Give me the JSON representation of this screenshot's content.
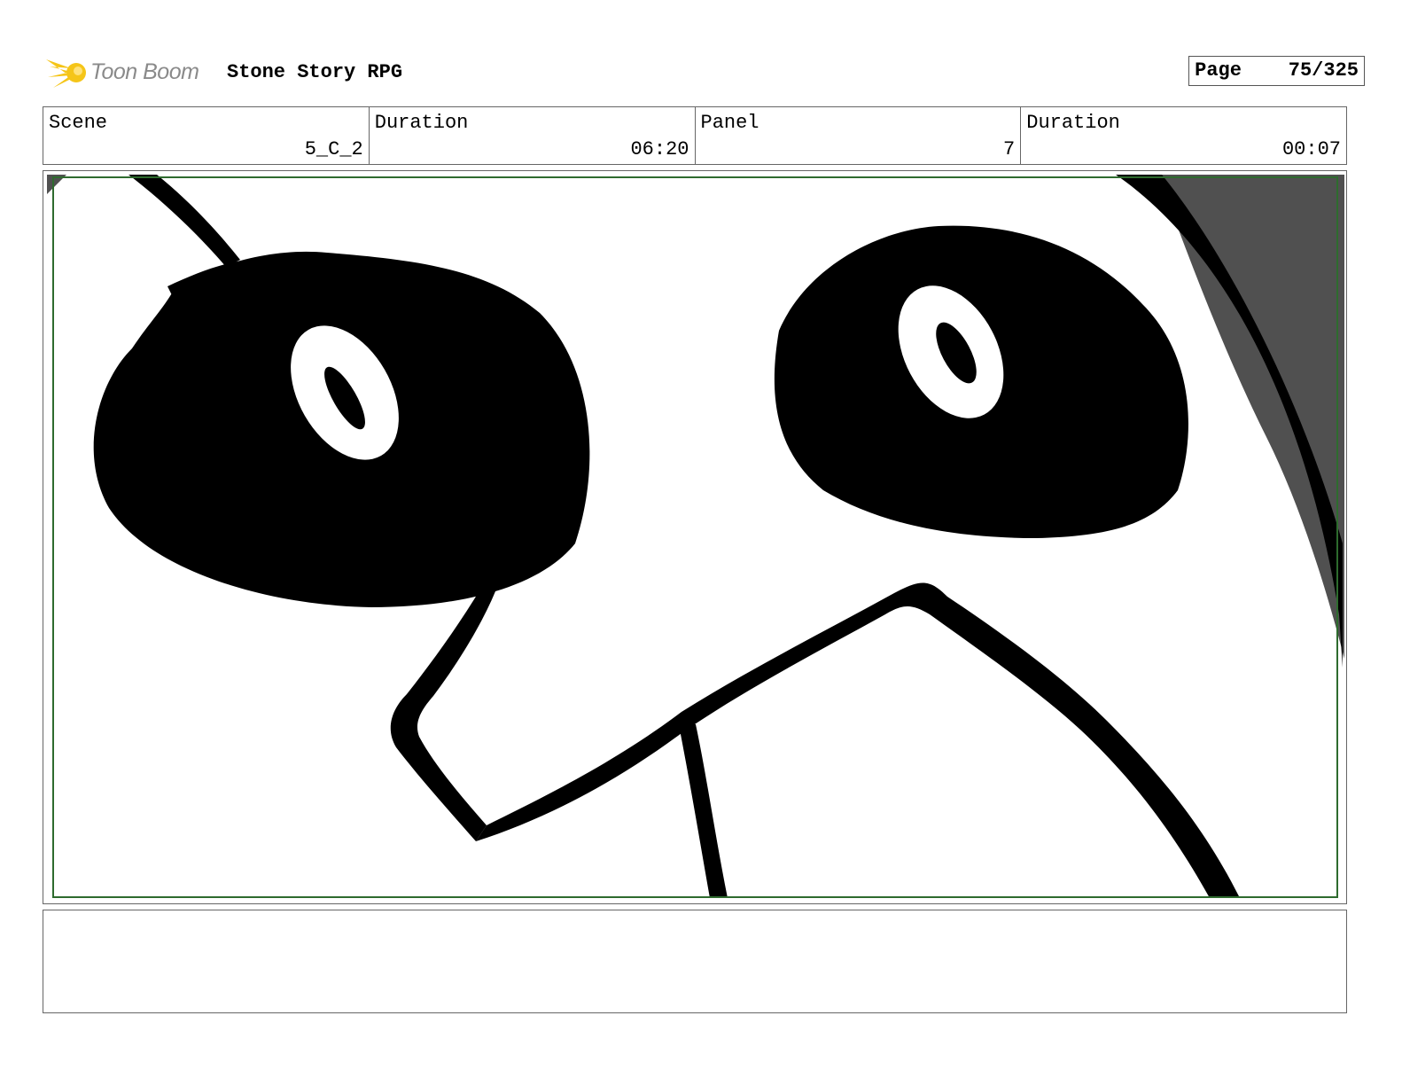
{
  "header": {
    "logo_text": "Toon Boom",
    "project_title": "Stone Story RPG",
    "page_label": "Page",
    "page_value": "75/325"
  },
  "info": {
    "scene_label": "Scene",
    "scene_value": "5_C_2",
    "scene_duration_label": "Duration",
    "scene_duration_value": "06:20",
    "panel_label": "Panel",
    "panel_value": "7",
    "panel_duration_label": "Duration",
    "panel_duration_value": "00:07"
  },
  "colors": {
    "accent_logo": "#f5c518",
    "safe_frame": "#2e6b2e",
    "shade": "#505050"
  },
  "icons": {
    "logo": "toon-boom-logo-icon"
  },
  "notes": {
    "text": ""
  }
}
